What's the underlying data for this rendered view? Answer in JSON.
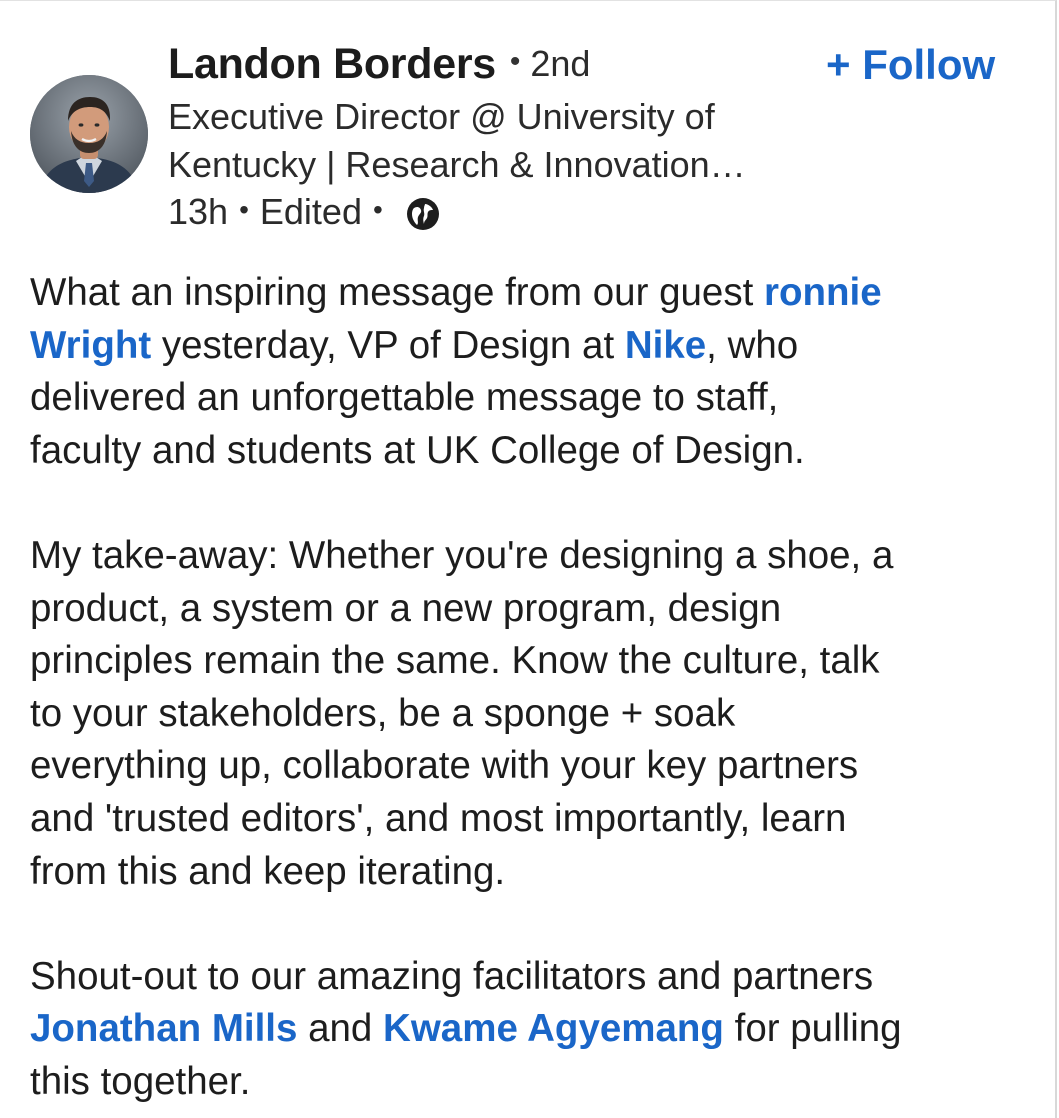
{
  "post": {
    "author": {
      "name": "Landon Borders",
      "separator": "•",
      "degree": "2nd",
      "headline_line1": "Executive Director @ University of",
      "headline_line2": "Kentucky | Research & Innovation…"
    },
    "follow_label": "+ Follow",
    "meta": {
      "time": "13h",
      "separator": "•",
      "edited": "Edited",
      "visibility_icon": "globe-icon"
    },
    "body": {
      "p1_l1_a": "What an inspiring message from our guest ",
      "mention_ronnie_a": "ronnie",
      "mention_ronnie_b": "Wright",
      "p1_l2_b": " yesterday, VP of Design at ",
      "mention_nike": "Nike",
      "p1_l2_c": ", who",
      "p1_l3": "delivered an unforgettable message to staff,",
      "p1_l4": "faculty and students at UK College of Design.",
      "p2_l1": "My take-away: Whether you're designing a shoe, a",
      "p2_l2": "product, a system or a new program, design",
      "p2_l3": "principles remain the same.  Know the culture, talk",
      "p2_l4": "to your stakeholders, be a sponge + soak",
      "p2_l5": "everything up, collaborate with your key partners",
      "p2_l6": "and 'trusted editors', and most importantly, learn",
      "p2_l7": "from this and keep iterating.",
      "p3_l1": "Shout-out to our amazing facilitators and partners",
      "mention_jonathan": "Jonathan Mills",
      "p3_l2_b": " and ",
      "mention_kwame": "Kwame Agyemang",
      "p3_l2_c": " for pulling",
      "p3_l3": "this together."
    }
  },
  "colors": {
    "link": "#1a66c8",
    "text": "#1d1d1d"
  }
}
